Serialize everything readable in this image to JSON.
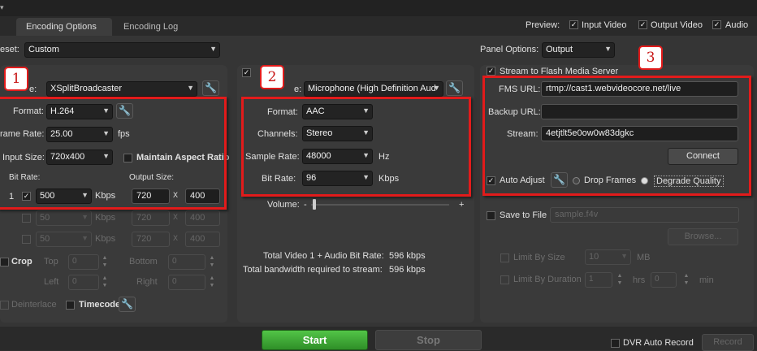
{
  "tabs": [
    {
      "label": "Encoding Options"
    },
    {
      "label": "Encoding Log"
    }
  ],
  "preview": {
    "label": "Preview:",
    "input_video": "Input Video",
    "output_video": "Output Video",
    "audio": "Audio"
  },
  "preset": {
    "label": "eset:",
    "value": "Custom"
  },
  "panel_options": {
    "label": "Panel Options:",
    "value": "Output"
  },
  "badges": {
    "one": "1",
    "two": "2",
    "three": "3"
  },
  "video": {
    "device_label": "e:",
    "device": "XSplitBroadcaster",
    "format_label": "Format:",
    "format": "H.264",
    "frame_rate_label": "rame Rate:",
    "frame_rate": "25.00",
    "frame_rate_unit": "fps",
    "input_size_label": "Input Size:",
    "input_size": "720x400",
    "maintain_aspect": "Maintain Aspect Ratio",
    "bit_rate_label": "Bit Rate:",
    "output_size_label": "Output Size:",
    "row1_index": "1",
    "bitrate1": "500",
    "kbps": "Kbps",
    "out_w": "720",
    "x": "X",
    "out_h": "400",
    "bitrate2": "50",
    "out_w2": "720",
    "out_h2": "400",
    "bitrate3": "50",
    "out_w3": "720",
    "out_h3": "400",
    "crop": "Crop",
    "top": "Top",
    "bottom": "Bottom",
    "left": "Left",
    "right": "Right",
    "zero": "0",
    "deinterlace": "Deinterlace",
    "timecode": "Timecode"
  },
  "audio": {
    "device_label": "e:",
    "device": "Microphone (High Definition Aud",
    "format_label": "Format:",
    "format": "AAC",
    "channels_label": "Channels:",
    "channels": "Stereo",
    "sample_rate_label": "Sample Rate:",
    "sample_rate": "48000",
    "hz": "Hz",
    "bit_rate_label": "Bit Rate:",
    "bit_rate": "96",
    "kbps": "Kbps",
    "volume_label": "Volume:",
    "vol_minus": "-",
    "vol_plus": "+",
    "total_label": "Total Video 1 + Audio Bit Rate:",
    "total_value": "596 kbps",
    "bandwidth_label": "Total bandwidth required to stream:",
    "bandwidth_value": "596 kbps"
  },
  "fms": {
    "stream_to": "Stream to Flash Media Server",
    "fms_url_label": "FMS URL:",
    "fms_url": "rtmp://cast1.webvideocore.net/live",
    "backup_url_label": "Backup URL:",
    "backup_url": "",
    "stream_label": "Stream:",
    "stream": "4etjtlt5e0ow0w83dgkc",
    "connect": "Connect",
    "auto_adjust": "Auto Adjust",
    "drop_frames": "Drop Frames",
    "degrade_quality": "Degrade Quality",
    "save_to_file": "Save to File",
    "file_placeholder": "sample.f4v",
    "browse": "Browse...",
    "limit_size": "Limit By Size",
    "limit_size_value": "10",
    "mb": "MB",
    "limit_duration": "Limit By Duration",
    "hrs_value": "1",
    "hrs": "hrs",
    "min_value": "0",
    "min": "min"
  },
  "bottom": {
    "start": "Start",
    "stop": "Stop",
    "dvr": "DVR Auto Record",
    "record": "Record"
  },
  "colors": {
    "accent_red": "#e21b1b",
    "start_green": "#3fae37"
  }
}
